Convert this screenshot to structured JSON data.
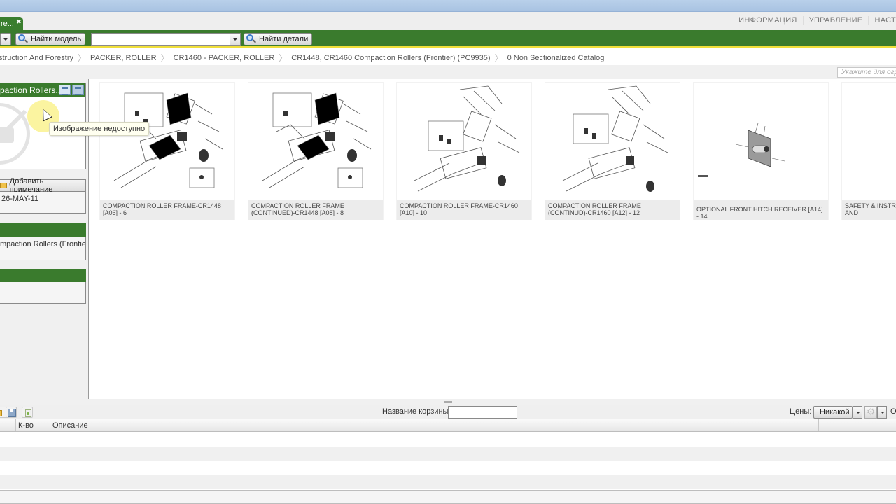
{
  "window": {
    "tab_label": "re...",
    "tab_close_icon": "close-icon"
  },
  "topnav": {
    "links": [
      "ИНФОРМАЦИЯ",
      "УПРАВЛЕНИЕ",
      "НАСТ"
    ]
  },
  "toolbar": {
    "find_model_label": "Найти модель",
    "search_value": "",
    "find_parts_label": "Найти детали"
  },
  "breadcrumb": [
    "struction And Forestry",
    "PACKER, ROLLER",
    "CR1460 - PACKER, ROLLER",
    "CR1448, CR1460 Compaction Rollers (Frontier) (PC9935)",
    "0 Non Sectionalized Catalog"
  ],
  "filter": {
    "placeholder": "Укажите для огр"
  },
  "left_panel": {
    "title": "paction Rollers...",
    "image_unavailable_tooltip": "Изображение недоступно",
    "add_note_label": "Добавить примечание",
    "date": "26-MAY-11",
    "description": "mpaction Rollers (Frontier):"
  },
  "catalog": {
    "cards": [
      {
        "caption": "COMPACTION ROLLER FRAME-CR1448 [A06] - 6"
      },
      {
        "caption": "COMPACTION ROLLER FRAME (CONTINUED)-CR1448 [A08] - 8"
      },
      {
        "caption": "COMPACTION ROLLER FRAME-CR1460 [A10] - 10"
      },
      {
        "caption": "COMPACTION ROLLER FRAME (CONTINUD)-CR1460 [A12] - 12"
      },
      {
        "caption": "OPTIONAL FRONT HITCH RECEIVER [A14] - 14"
      },
      {
        "caption": "SAFETY & INSTRUCTION REFLECTORS AND"
      }
    ]
  },
  "basket": {
    "name_label": "Название корзины:",
    "name_value": "",
    "prices_label": "Цены:",
    "prices_value": "Никакой",
    "trailing_label": "О"
  },
  "parts_table": {
    "columns": [
      "",
      "К-во",
      "Описание",
      ""
    ],
    "rows": []
  }
}
